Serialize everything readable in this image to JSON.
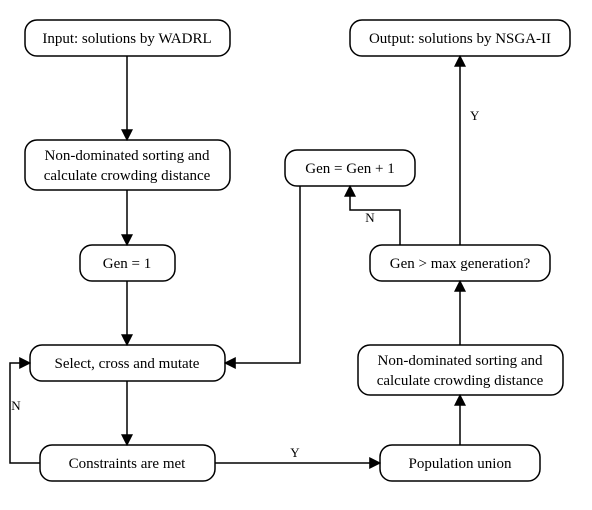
{
  "nodes": {
    "input": {
      "label": "Input: solutions by WADRL"
    },
    "sort1": {
      "line1": "Non-dominated sorting and",
      "line2": "calculate crowding distance"
    },
    "geninit": {
      "label": "Gen = 1"
    },
    "select": {
      "label": "Select, cross and mutate"
    },
    "constraints": {
      "label": "Constraints are met"
    },
    "popunion": {
      "label": "Population union"
    },
    "sort2": {
      "line1": "Non-dominated sorting and",
      "line2": "calculate crowding distance"
    },
    "gentest": {
      "label": "Gen > max generation?"
    },
    "geninc": {
      "label": "Gen = Gen + 1"
    },
    "output": {
      "label": "Output: solutions by NSGA-II"
    }
  },
  "edge_labels": {
    "constraints_no": "N",
    "constraints_yes": "Y",
    "gentest_no": "N",
    "gentest_yes": "Y"
  }
}
